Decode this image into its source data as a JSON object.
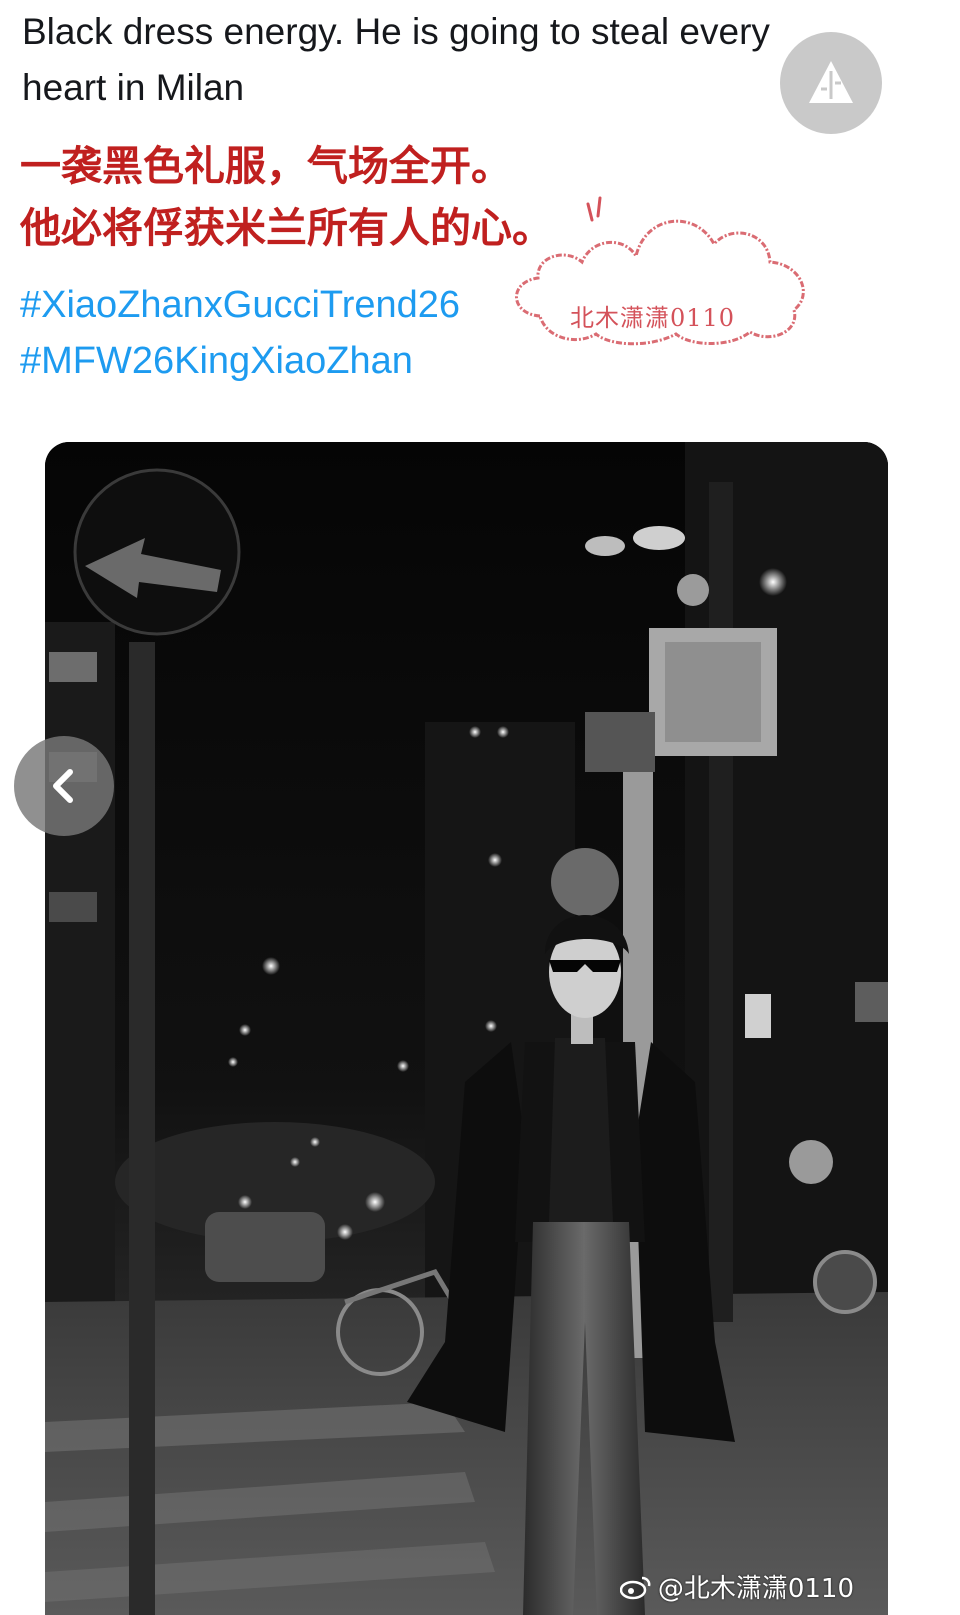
{
  "tweet": {
    "text_line1": "Black dress energy. He is going to steal every",
    "text_line2": "heart in Milan"
  },
  "translation": {
    "line1": "一袭黑色礼服，气场全开。",
    "line2": "他必将俘获米兰所有人的心。"
  },
  "hashtags": [
    "#XiaoZhanxGucciTrend26",
    "#MFW26KingXiaoZhan"
  ],
  "stamp": {
    "text": "北木潇潇0110"
  },
  "watermark": {
    "text": "@北木潇潇0110"
  },
  "icons": {
    "translate": "translate-icon",
    "prev": "chevron-left-icon",
    "weibo": "weibo-logo-icon"
  },
  "colors": {
    "translation_red": "#c0201f",
    "hashtag_blue": "#1d9bf0",
    "stamp_pink": "#d4525a"
  }
}
